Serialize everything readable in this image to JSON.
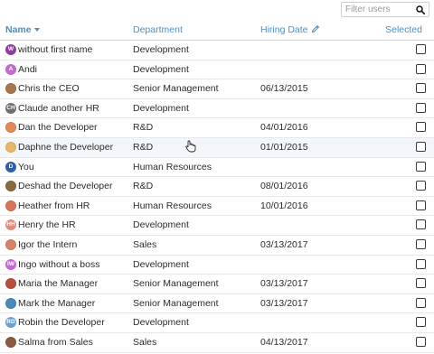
{
  "filter": {
    "placeholder": "Filter users",
    "icon": "search-icon"
  },
  "columns": {
    "name": "Name",
    "department": "Department",
    "hiring_date": "Hiring Date",
    "selected": "Selected"
  },
  "colors": {
    "accent": "#4a90c8",
    "header_text": "#4a90c8",
    "border": "#d4d4d4"
  },
  "rows": [
    {
      "name": "without first name",
      "department": "Development",
      "date": "",
      "avatar": "W",
      "avatar_color": "#8e3fa0",
      "avatar_type": "initial",
      "selected": false
    },
    {
      "name": "Andi",
      "department": "Development",
      "date": "",
      "avatar": "A",
      "avatar_color": "#c368d1",
      "avatar_type": "initial",
      "selected": false
    },
    {
      "name": "Chris the CEO",
      "department": "Senior Management",
      "date": "06/13/2015",
      "avatar": "",
      "avatar_color": "#a9754f",
      "avatar_type": "photo",
      "selected": false
    },
    {
      "name": "Claude another HR",
      "department": "Development",
      "date": "",
      "avatar": "CH",
      "avatar_color": "#6f6f6f",
      "avatar_type": "initial",
      "selected": false
    },
    {
      "name": "Dan the Developer",
      "department": "R&D",
      "date": "04/01/2016",
      "avatar": "",
      "avatar_color": "#e08a5a",
      "avatar_type": "photo",
      "selected": false
    },
    {
      "name": "Daphne the Developer",
      "department": "R&D",
      "date": "01/01/2015",
      "avatar": "",
      "avatar_color": "#e7b86b",
      "avatar_type": "photo",
      "selected": false
    },
    {
      "name": "You",
      "department": "Human Resources",
      "date": "",
      "avatar": "D",
      "avatar_color": "#2f5fa5",
      "avatar_type": "initial",
      "selected": false
    },
    {
      "name": "Deshad the Developer",
      "department": "R&D",
      "date": "08/01/2016",
      "avatar": "",
      "avatar_color": "#8a6a3f",
      "avatar_type": "photo",
      "selected": false
    },
    {
      "name": "Heather from HR",
      "department": "Human Resources",
      "date": "10/01/2016",
      "avatar": "",
      "avatar_color": "#d8745a",
      "avatar_type": "photo",
      "selected": false
    },
    {
      "name": "Henry the HR",
      "department": "Development",
      "date": "",
      "avatar": "HH",
      "avatar_color": "#e08a7a",
      "avatar_type": "initial",
      "selected": false
    },
    {
      "name": "Igor the Intern",
      "department": "Sales",
      "date": "03/13/2017",
      "avatar": "",
      "avatar_color": "#d9826b",
      "avatar_type": "photo",
      "selected": false
    },
    {
      "name": "Ingo without a boss",
      "department": "Development",
      "date": "",
      "avatar": "IW",
      "avatar_color": "#c368d1",
      "avatar_type": "initial",
      "selected": false
    },
    {
      "name": "Maria the Manager",
      "department": "Senior Management",
      "date": "03/13/2017",
      "avatar": "",
      "avatar_color": "#b8503e",
      "avatar_type": "photo",
      "selected": false
    },
    {
      "name": "Mark the Manager",
      "department": "Senior Management",
      "date": "03/13/2017",
      "avatar": "",
      "avatar_color": "#4a8ab8",
      "avatar_type": "photo",
      "selected": false
    },
    {
      "name": "Robin the Developer",
      "department": "Development",
      "date": "",
      "avatar": "RD",
      "avatar_color": "#6a9fd6",
      "avatar_type": "initial",
      "selected": false
    },
    {
      "name": "Salma from Sales",
      "department": "Sales",
      "date": "04/13/2017",
      "avatar": "",
      "avatar_color": "#8a5a3f",
      "avatar_type": "photo",
      "selected": false
    }
  ]
}
